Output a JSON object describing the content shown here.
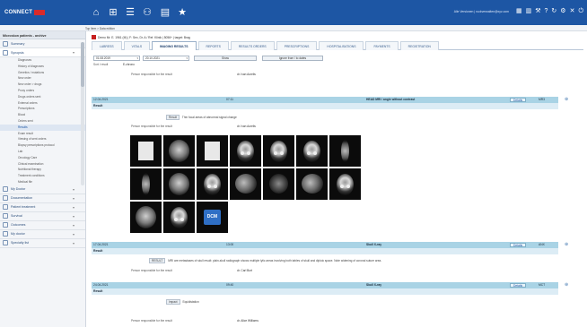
{
  "app": {
    "logo_text": "CONNECT",
    "logo_subtext": "",
    "user_text": "Alle Versionen | ruckverwalten@xyz.com"
  },
  "nav": {
    "icons": [
      "home-icon",
      "hierarchy-icon",
      "list-icon",
      "users-chart-icon",
      "chart-icon",
      "star-icon"
    ]
  },
  "topright": {
    "icons": [
      "grid-icon",
      "filter-icon",
      "tools-icon",
      "help-icon",
      "refresh-icon",
      "settings-icon",
      "close-icon",
      "logout-icon"
    ]
  },
  "breadcrumb": "Top Item > Data edition",
  "sidebar": {
    "header": "Microskon patients - archive",
    "main_items": [
      {
        "label": "Summary",
        "icon": "summary-icon"
      },
      {
        "label": "Synopsis",
        "icon": "synopsis-icon"
      }
    ],
    "sub_items": [
      "Diagnoses",
      "History of diagnoses",
      "Genetics / mutations",
      "New order",
      "New order > drugs",
      "Proxy orders",
      "Drugs orders sent",
      "External orders",
      "Prescriptions",
      "Blood",
      "Orders sent",
      "Results",
      "Exam result",
      "Viewing of sent orders",
      "Biopsy prescriptions protocol",
      "Lab",
      "Oncology Care",
      "Clinical examination",
      "Nutritional therapy",
      "Treatment conditions",
      "Medical file"
    ],
    "selected_sub": "Results",
    "bottom_items": [
      {
        "label": "My Doctor",
        "icon": "doctor-icon"
      },
      {
        "label": "Documentation",
        "icon": "documentation-icon"
      },
      {
        "label": "Patient treatment",
        "icon": "treatment-icon"
      },
      {
        "label": "Survival",
        "icon": "survival-icon"
      },
      {
        "label": "Outcomes",
        "icon": "outcomes-icon"
      },
      {
        "label": "My doctor",
        "icon": "doctor2-icon"
      },
      {
        "label": "Specialty list",
        "icon": "specialty-icon"
      }
    ]
  },
  "patient": {
    "line": "Demo Mr. E. 1961 (M) | F: Sex, Dr. A / Ref. Klinik | 5056+ | target: Brag"
  },
  "tabs": [
    "LABRESS",
    "VITALS",
    "IMAGING RESULTS",
    "REPORTS",
    "RESULTS ORDERS",
    "PRESCRIPTIONS",
    "HOSPITALISATIONS",
    "PAYMENTS",
    "REGISTRATION"
  ],
  "active_tab": "IMAGING RESULTS",
  "filters": {
    "date_from": "01.08.2019",
    "date_to": "20.10.2021",
    "search_label": "Show",
    "reset_label": "Ignore from / to dates",
    "sort_label": "Sort / result",
    "sort_value": "E-chrono"
  },
  "exams": [
    {
      "date": "12.04.2021",
      "time": "07:11",
      "title": "HEAD MRI / angle without contrast",
      "details_label": "Details",
      "code": "MR3",
      "result_label": "Result",
      "responsible_label": "Person responsible for the result",
      "responsible_value": "dr. Ivan Aurelis",
      "result_tag": "Result",
      "result_text": "Thin focal areas of abnormal signal change"
    },
    {
      "date": "17.04.2021",
      "time": "13:00",
      "title": "Skull X-ray",
      "details_label": "Details",
      "code": "ANX",
      "result_label": "Result",
      "responsible_label": "Person responsible for the result",
      "responsible_value": "dr. Carl Burt",
      "result_tag": "RESULT",
      "result_text": "MRI are metastases of skull result: plain-skull radiograph shows multiple lytic areas involving both tables of skull and diploic space. Note widening of coronal suture area."
    },
    {
      "date": "24.04.2021",
      "time": "09:40",
      "title": "Skull X-ray",
      "details_label": "Details",
      "code": "MCT",
      "result_label": "Result",
      "responsible_label": "Person responsible for the result",
      "responsible_value": "dr. Alice Williams",
      "result_tag": "Impact",
      "result_text": "Equidistation"
    }
  ],
  "top_responsible": {
    "label": "Person responsible for the result",
    "value": "dr. Ivan Aurelis"
  },
  "thumbnails": [
    "document",
    "mri-brain",
    "document",
    "mri-skull",
    "mri-skull",
    "mri-skull",
    "mri-tree",
    "mri-tree",
    "mri-brain",
    "mri-skull",
    "mri-sagittal",
    "mri-axial",
    "mri-sagittal",
    "mri-skull",
    "mri-brain",
    "mri-skull",
    "dcm"
  ],
  "dcm_label": "DCM"
}
